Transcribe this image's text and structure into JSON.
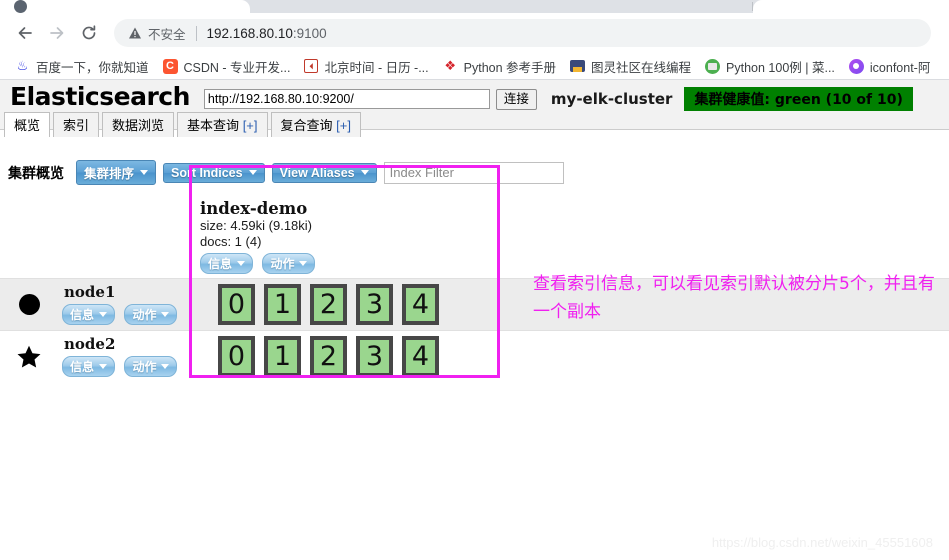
{
  "browser": {
    "nav": {
      "back": "back-arrow",
      "forward": "forward-arrow",
      "reload": "reload"
    },
    "omnibox": {
      "security_warning": "不安全",
      "url": "192.168.80.10:9100",
      "url_host": "192.168.80.10",
      "url_port": ":9100"
    },
    "bookmarks": [
      {
        "label": "百度一下，你就知道",
        "icon": "baidu-icon"
      },
      {
        "label": "CSDN - 专业开发...",
        "icon": "csdn-icon"
      },
      {
        "label": "北京时间 - 日历 -...",
        "icon": "clock-icon"
      },
      {
        "label": "Python 参考手册",
        "icon": "python-icon"
      },
      {
        "label": "图灵社区在线编程",
        "icon": "turing-icon"
      },
      {
        "label": "Python 100例 | 菜...",
        "icon": "runoob-icon"
      },
      {
        "label": "iconfont-阿",
        "icon": "iconfont-icon"
      }
    ]
  },
  "app": {
    "logo": "Elasticsearch",
    "url_value": "http://192.168.80.10:9200/",
    "connect_label": "连接",
    "cluster_name": "my-elk-cluster",
    "health_badge": "集群健康值: green (10 of 10)",
    "health_color": "#008000",
    "tabs": [
      {
        "label": "概览",
        "active": true
      },
      {
        "label": "索引",
        "active": false
      },
      {
        "label": "数据浏览",
        "active": false
      },
      {
        "label": "基本查询",
        "suffix": "[+]",
        "active": false
      },
      {
        "label": "复合查询",
        "suffix": "[+]",
        "active": false
      }
    ],
    "toolbar": {
      "title": "集群概览",
      "sort_cluster_label": "集群排序",
      "sort_indices_label": "Sort Indices",
      "view_aliases_label": "View Aliases",
      "index_filter_placeholder": "Index Filter",
      "index_filter_value": ""
    },
    "index": {
      "name": "index-demo",
      "size": "size: 4.59ki (9.18ki)",
      "docs": "docs: 1 (4)",
      "info_label": "信息",
      "action_label": "动作"
    },
    "nodes": [
      {
        "name": "node1",
        "icon": "circle-node-icon",
        "info_label": "信息",
        "action_label": "动作",
        "shards": [
          "0",
          "1",
          "2",
          "3",
          "4"
        ]
      },
      {
        "name": "node2",
        "icon": "star-master-node-icon",
        "info_label": "信息",
        "action_label": "动作",
        "shards": [
          "0",
          "1",
          "2",
          "3",
          "4"
        ]
      }
    ],
    "shard_color": "#9ad68e"
  },
  "annotation": {
    "text": "查看索引信息，可以看见索引默认被分片5个，并且有一个副本",
    "color": "#f020f0"
  },
  "watermark": "https://blog.csdn.net/weixin_45551608"
}
